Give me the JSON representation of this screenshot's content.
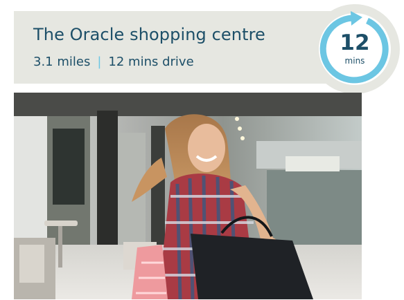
{
  "location": {
    "name": "The Oracle shopping centre",
    "distance": "3.1 miles",
    "separator": "|",
    "drive_time": "12 mins drive"
  },
  "badge": {
    "value": "12",
    "unit": "mins",
    "icon": "clock-arrow-icon"
  },
  "photo": {
    "subject": "woman-with-shopping-bags"
  },
  "colors": {
    "panel": "#e6e7e1",
    "navy": "#1d4f68",
    "cyan": "#6cc6e3"
  }
}
